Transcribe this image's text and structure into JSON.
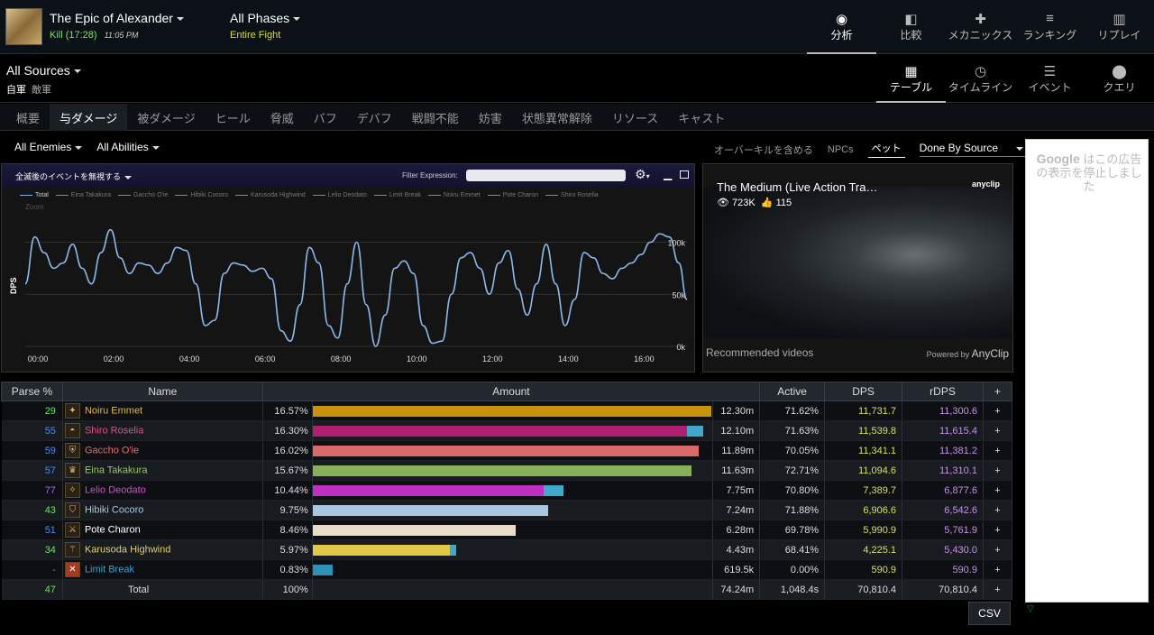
{
  "fight": {
    "title": "The Epic of Alexander",
    "result": "Kill (17:28)",
    "time": "11:05 PM"
  },
  "phase": {
    "title": "All Phases",
    "sub": "Entire Fight"
  },
  "nav": [
    {
      "icon": "eye-icon",
      "label": "分析",
      "active": true
    },
    {
      "icon": "compare-icon",
      "label": "比較"
    },
    {
      "icon": "puzzle-icon",
      "label": "メカニックス"
    },
    {
      "icon": "ranking-icon",
      "label": "ランキング"
    },
    {
      "icon": "replay-icon",
      "label": "リプレイ"
    }
  ],
  "sources": {
    "title": "All Sources",
    "friendly": "自軍",
    "enemy": "敵軍"
  },
  "views": [
    {
      "icon": "grid-icon",
      "label": "テーブル",
      "active": true
    },
    {
      "icon": "clock-icon",
      "label": "タイムライン"
    },
    {
      "icon": "list-icon",
      "label": "イベント"
    },
    {
      "icon": "pin-icon",
      "label": "クエリ"
    }
  ],
  "tabs": [
    "概要",
    "与ダメージ",
    "被ダメージ",
    "ヒール",
    "脅威",
    "バフ",
    "デバフ",
    "戦闘不能",
    "妨害",
    "状態異常解除",
    "リソース",
    "キャスト"
  ],
  "active_tab": 1,
  "filters": {
    "enemies": "All Enemies",
    "abilities": "All Abilities"
  },
  "right_filters": {
    "overkill": "オーバーキルを含める",
    "npcs": "NPCs",
    "pets": "ペット",
    "done_by": "Done By Source"
  },
  "graph": {
    "ignore_label": "全滅後のイベントを無視する",
    "filter_label": "Filter Expression:",
    "zoom_label": "Zoom",
    "legend": [
      "Total",
      "Eina Takakura",
      "Gaccho O'ie",
      "Hibiki Cocoro",
      "Karusoda Highwind",
      "Lelio Deodato",
      "Limit Break",
      "Noiru Emmet",
      "Pote Charon",
      "Shiro Roselia"
    ],
    "ylabel": "DPS",
    "yticks": [
      "100k",
      "50k",
      "0k"
    ],
    "xticks": [
      "00:00",
      "02:00",
      "04:00",
      "06:00",
      "08:00",
      "10:00",
      "12:00",
      "14:00",
      "16:00"
    ]
  },
  "chart_data": {
    "type": "line",
    "xlabel": "",
    "ylabel": "DPS",
    "ylim": [
      0,
      120000
    ],
    "series": [
      {
        "name": "Total",
        "x": [
          0,
          15,
          30,
          45,
          60,
          75,
          90,
          105,
          120,
          135,
          150,
          165,
          180,
          195,
          210,
          225,
          240,
          255,
          270,
          285,
          300,
          315,
          330,
          345,
          360,
          375,
          390,
          405,
          420,
          435,
          450,
          465,
          480,
          495,
          510,
          525,
          540,
          555,
          570,
          585,
          600,
          615,
          630,
          645,
          660,
          675,
          690,
          705,
          720,
          735,
          750,
          765,
          780,
          795,
          810,
          825,
          840,
          855,
          870,
          885,
          900,
          915,
          930,
          945,
          960,
          975,
          990,
          1005,
          1020,
          1035,
          1048
        ],
        "values": [
          60000,
          105000,
          90000,
          75000,
          80000,
          98000,
          75000,
          60000,
          90000,
          112000,
          85000,
          70000,
          80000,
          78000,
          70000,
          80000,
          95000,
          92000,
          60000,
          20000,
          25000,
          70000,
          80000,
          78000,
          72000,
          75000,
          65000,
          15000,
          5000,
          40000,
          95000,
          80000,
          20000,
          8000,
          60000,
          100000,
          40000,
          0,
          30000,
          75000,
          82000,
          70000,
          20000,
          3000,
          5000,
          50000,
          85000,
          90000,
          75000,
          50000,
          80000,
          92000,
          55000,
          30000,
          60000,
          98000,
          60000,
          20000,
          45000,
          90000,
          85000,
          70000,
          65000,
          75000,
          80000,
          88000,
          100000,
          108000,
          105000,
          80000,
          45000
        ]
      }
    ]
  },
  "video": {
    "title": "The Medium (Live Action Tra…",
    "views": "723K",
    "likes": "115",
    "brand": "anyclip",
    "recommended": "Recommended videos",
    "powered": "Powered by",
    "powered_brand": "AnyClip"
  },
  "ad": {
    "brand": "Google",
    "text": "はこの広告の表示を停止しました"
  },
  "table": {
    "headers": [
      "Parse %",
      "Name",
      "Amount",
      "Active",
      "DPS",
      "rDPS",
      "+"
    ],
    "rows": [
      {
        "parse": "29",
        "parse_color": "#6ce06c",
        "name": "Noiru Emmet",
        "name_color": "#e8b830",
        "job": "NIN",
        "pct": "16.57%",
        "amount": "12.30m",
        "active": "71.62%",
        "dps": "11,731.7",
        "rdps": "11,300.6",
        "bars": [
          {
            "frac": 1.0,
            "color": "#c8920c"
          }
        ]
      },
      {
        "parse": "55",
        "parse_color": "#4a8cf0",
        "name": "Shiro Roselia",
        "name_color": "#e84a8a",
        "job": "RPR",
        "pct": "16.30%",
        "amount": "12.10m",
        "active": "71.63%",
        "dps": "11,539.8",
        "rdps": "11,615.4",
        "bars": [
          {
            "frac": 0.94,
            "color": "#b02070"
          },
          {
            "frac": 0.04,
            "color": "#40a8c8"
          }
        ]
      },
      {
        "parse": "59",
        "parse_color": "#4a8cf0",
        "name": "Gaccho O'ie",
        "name_color": "#f06a6a",
        "job": "PLD",
        "pct": "16.02%",
        "amount": "11.89m",
        "active": "70.05%",
        "dps": "11,341.1",
        "rdps": "11,381.2",
        "bars": [
          {
            "frac": 0.97,
            "color": "#d86a6a"
          }
        ]
      },
      {
        "parse": "57",
        "parse_color": "#4a8cf0",
        "name": "Eina Takakura",
        "name_color": "#98c860",
        "job": "WHM",
        "pct": "15.67%",
        "amount": "11.63m",
        "active": "72.71%",
        "dps": "11,094.6",
        "rdps": "11,310.1",
        "bars": [
          {
            "frac": 0.95,
            "color": "#88b058"
          }
        ]
      },
      {
        "parse": "77",
        "parse_color": "#a868e8",
        "name": "Lelio Deodato",
        "name_color": "#e040e0",
        "job": "DNC",
        "pct": "10.44%",
        "amount": "7.75m",
        "active": "70.80%",
        "dps": "7,389.7",
        "rdps": "6,877.6",
        "bars": [
          {
            "frac": 0.58,
            "color": "#c030c0"
          },
          {
            "frac": 0.05,
            "color": "#40a8c8"
          }
        ]
      },
      {
        "parse": "43",
        "parse_color": "#6ce06c",
        "name": "Hibiki Cocoro",
        "name_color": "#a8c8e0",
        "job": "SCH",
        "pct": "9.75%",
        "amount": "7.24m",
        "active": "71.88%",
        "dps": "6,906.6",
        "rdps": "6,542.6",
        "bars": [
          {
            "frac": 0.59,
            "color": "#a8c8e0"
          }
        ]
      },
      {
        "parse": "51",
        "parse_color": "#4a8cf0",
        "name": "Pote Charon",
        "name_color": "#ffffff",
        "job": "SAM",
        "pct": "8.46%",
        "amount": "6.28m",
        "active": "69.78%",
        "dps": "5,990.9",
        "rdps": "5,761.9",
        "bars": [
          {
            "frac": 0.51,
            "color": "#e8dcc8"
          }
        ]
      },
      {
        "parse": "34",
        "parse_color": "#6ce06c",
        "name": "Karusoda Highwind",
        "name_color": "#e8d050",
        "job": "DRG",
        "pct": "5.97%",
        "amount": "4.43m",
        "active": "68.41%",
        "dps": "4,225.1",
        "rdps": "5,430.0",
        "bars": [
          {
            "frac": 0.345,
            "color": "#e0c848"
          },
          {
            "frac": 0.015,
            "color": "#40a8c8"
          }
        ]
      },
      {
        "parse": "-",
        "parse_color": "#4a8cf0",
        "name": "Limit Break",
        "name_color": "#3aa0d8",
        "job": "LB",
        "pct": "0.83%",
        "amount": "619.5k",
        "active": "0.00%",
        "dps": "590.9",
        "rdps": "590.9",
        "bars": [
          {
            "frac": 0.05,
            "color": "#3090b8"
          }
        ]
      }
    ],
    "total": {
      "parse": "47",
      "name": "Total",
      "pct": "100%",
      "amount": "74.24m",
      "active": "1,048.4s",
      "dps": "70,810.4",
      "rdps": "70,810.4"
    }
  },
  "csv_label": "CSV"
}
